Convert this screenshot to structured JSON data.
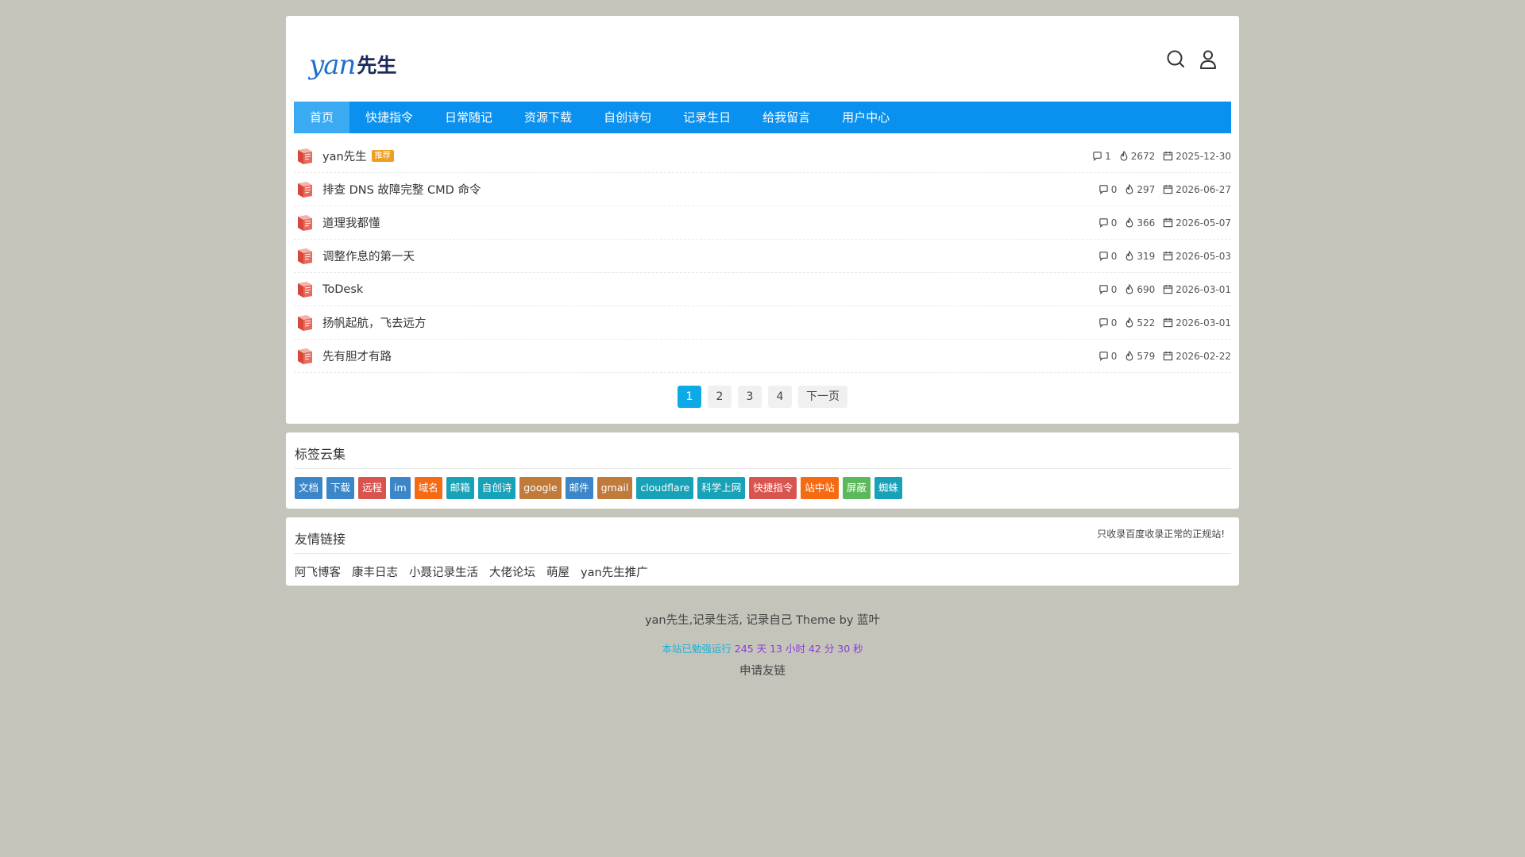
{
  "header": {
    "logo_en": "yan",
    "logo_cn": "先生",
    "search_icon": "search-icon",
    "user_icon": "user-icon"
  },
  "nav": {
    "items": [
      {
        "label": "首页",
        "active": true
      },
      {
        "label": "快捷指令"
      },
      {
        "label": "日常随记"
      },
      {
        "label": "资源下载"
      },
      {
        "label": "自创诗句"
      },
      {
        "label": "记录生日"
      },
      {
        "label": "给我留言"
      },
      {
        "label": "用户中心"
      }
    ]
  },
  "posts": [
    {
      "title": "yan先生",
      "badge": "推荐",
      "comments": "1",
      "views": "2672",
      "date": "2025-12-30"
    },
    {
      "title": "排查 DNS 故障完整 CMD 命令",
      "comments": "0",
      "views": "297",
      "date": "2026-06-27"
    },
    {
      "title": "道理我都懂",
      "comments": "0",
      "views": "366",
      "date": "2026-05-07"
    },
    {
      "title": "调整作息的第一天",
      "comments": "0",
      "views": "319",
      "date": "2026-05-03"
    },
    {
      "title": "ToDesk",
      "comments": "0",
      "views": "690",
      "date": "2026-03-01"
    },
    {
      "title": "扬帆起航，飞去远方",
      "comments": "0",
      "views": "522",
      "date": "2026-03-01"
    },
    {
      "title": "先有胆才有路",
      "comments": "0",
      "views": "579",
      "date": "2026-02-22"
    }
  ],
  "pagination": {
    "pages": [
      "1",
      "2",
      "3",
      "4"
    ],
    "current": "1",
    "next_label": "下一页"
  },
  "tag_cloud": {
    "title": "标签云集",
    "tags": [
      {
        "label": "文档",
        "color": "#3a86c8"
      },
      {
        "label": "下载",
        "color": "#3a86c8"
      },
      {
        "label": "远程",
        "color": "#d9534f"
      },
      {
        "label": "im",
        "color": "#3a86c8"
      },
      {
        "label": "域名",
        "color": "#f56a12"
      },
      {
        "label": "邮箱",
        "color": "#17a2b8"
      },
      {
        "label": "自创诗",
        "color": "#17a2b8"
      },
      {
        "label": "google",
        "color": "#c07a3a"
      },
      {
        "label": "邮件",
        "color": "#3a86c8"
      },
      {
        "label": "gmail",
        "color": "#c07a3a"
      },
      {
        "label": "cloudflare",
        "color": "#17a2b8"
      },
      {
        "label": "科学上网",
        "color": "#17a2b8"
      },
      {
        "label": "快捷指令",
        "color": "#d9534f"
      },
      {
        "label": "站中站",
        "color": "#f56a12"
      },
      {
        "label": "屏蔽",
        "color": "#5cb85c"
      },
      {
        "label": "蜘蛛",
        "color": "#17a2b8"
      }
    ]
  },
  "friend_links": {
    "title": "友情链接",
    "note": "只收录百度收录正常的正规站!",
    "links": [
      "阿飞博客",
      "康丰日志",
      "小聂记录生活",
      "大佬论坛",
      "萌屋",
      "yan先生推广"
    ]
  },
  "footer": {
    "site_text": "yan先生,记录生活, 记录自己 Theme by ",
    "theme_author": "蓝叶",
    "runtime": [
      {
        "text": "本站已勉强运行 ",
        "color": "#1eb0d8"
      },
      {
        "text": "245 天 13 小时 42 分 30 秒",
        "color": "#8a3ad8"
      }
    ],
    "apply_link": "申请友链"
  }
}
